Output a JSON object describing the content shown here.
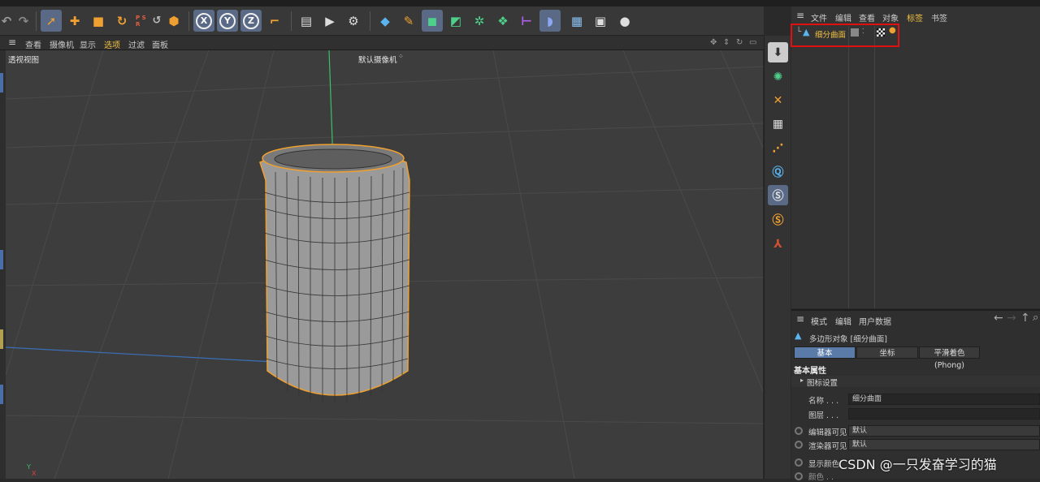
{
  "toolbar": {
    "coord_x": "X",
    "coord_y": "Y",
    "coord_z": "Z",
    "psr_label": "P S R"
  },
  "viewport": {
    "menu": [
      "查看",
      "摄像机",
      "显示",
      "选项",
      "过滤",
      "面板"
    ],
    "label": "透视视图",
    "camera": "默认摄像机"
  },
  "object_manager": {
    "menu": [
      "文件",
      "编辑",
      "查看",
      "对象",
      "标签",
      "书签"
    ],
    "object_name": "细分曲面"
  },
  "attributes": {
    "menu": [
      "模式",
      "编辑",
      "用户数据"
    ],
    "object_title": "多边形对象 [细分曲面]",
    "tabs": [
      "基本",
      "坐标",
      "平滑着色(Phong)"
    ],
    "section": "基本属性",
    "icon_settings": "图标设置",
    "name_label": "名称 . . .",
    "name_value": "细分曲面",
    "layer_label": "图层 . . .",
    "layer_value": "",
    "editor_visible_label": "编辑器可见",
    "editor_visible_value": "默认",
    "render_visible_label": "渲染器可见",
    "render_visible_value": "默认",
    "display_color_label": "显示颜色",
    "color_label": "颜色 . ."
  },
  "axis": {
    "y": "Y",
    "x": "X"
  },
  "watermark": "CSDN @一只发奋学习的猫",
  "colors": {
    "accent_orange": "#f0a030",
    "highlight_red": "#e01010",
    "active_blue": "#5a7aa8"
  }
}
